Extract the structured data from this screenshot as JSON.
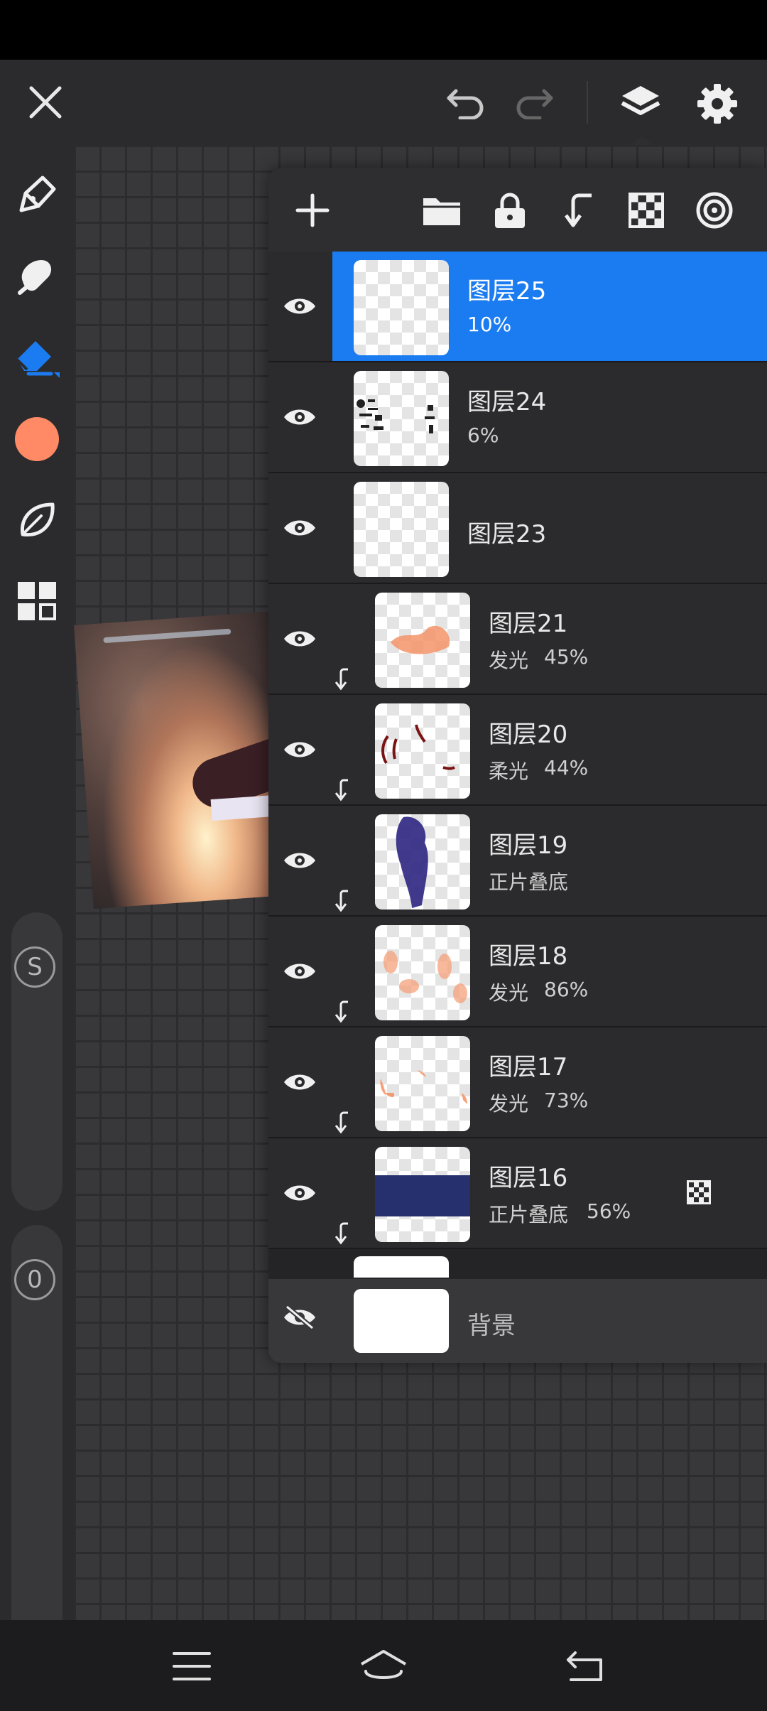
{
  "topbar": {
    "close_icon": "close-icon",
    "undo_icon": "undo-icon",
    "redo_icon": "redo-icon",
    "layers_icon": "layers-icon",
    "settings_icon": "gear-icon"
  },
  "tools": {
    "brush_color": "#ff8a65",
    "slider_size_label": "S",
    "slider_opacity_label": "0",
    "accent": "#1a7cf0"
  },
  "layers_panel": {
    "layers": [
      {
        "name": "图层25",
        "blend": "",
        "opacity": "10%",
        "visible": true,
        "clipped": false,
        "active": true
      },
      {
        "name": "图层24",
        "blend": "",
        "opacity": "6%",
        "visible": true,
        "clipped": false,
        "active": false
      },
      {
        "name": "图层23",
        "blend": "",
        "opacity": "",
        "visible": true,
        "clipped": false,
        "active": false
      },
      {
        "name": "图层21",
        "blend": "发光",
        "opacity": "45%",
        "visible": true,
        "clipped": true,
        "active": false
      },
      {
        "name": "图层20",
        "blend": "柔光",
        "opacity": "44%",
        "visible": true,
        "clipped": true,
        "active": false
      },
      {
        "name": "图层19",
        "blend": "正片叠底",
        "opacity": "",
        "visible": true,
        "clipped": true,
        "active": false
      },
      {
        "name": "图层18",
        "blend": "发光",
        "opacity": "86%",
        "visible": true,
        "clipped": true,
        "active": false
      },
      {
        "name": "图层17",
        "blend": "发光",
        "opacity": "73%",
        "visible": true,
        "clipped": true,
        "active": false
      },
      {
        "name": "图层16",
        "blend": "正片叠底",
        "opacity": "56%",
        "visible": true,
        "clipped": true,
        "active": false,
        "alpha_lock": true
      }
    ],
    "background": {
      "name": "背景",
      "visible": false
    }
  }
}
